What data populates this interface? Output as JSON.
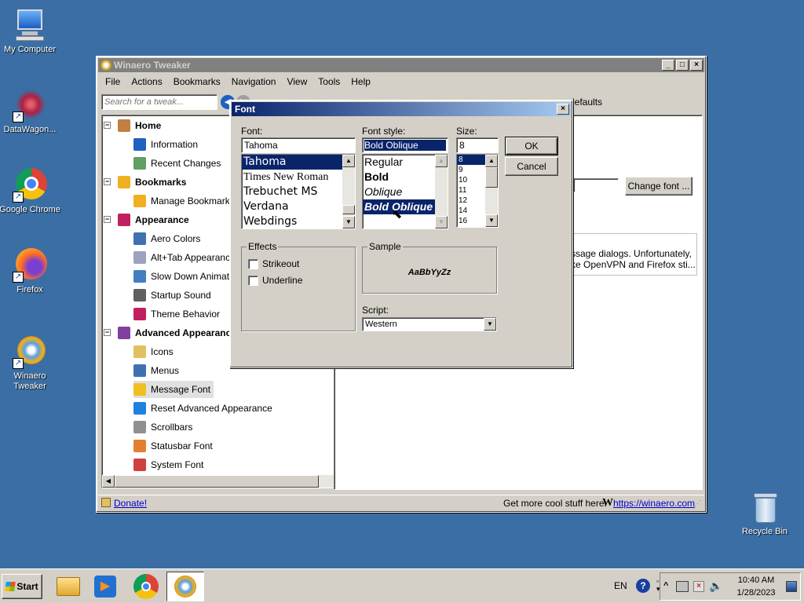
{
  "desktop": {
    "icons": [
      {
        "label": "My Computer"
      },
      {
        "label": "DataWagon..."
      },
      {
        "label": "Google Chrome"
      },
      {
        "label": "Firefox"
      },
      {
        "label": "Winaero\nTweaker"
      },
      {
        "label": "Recycle Bin"
      }
    ]
  },
  "main_window": {
    "title": "Winaero Tweaker",
    "menu": [
      "File",
      "Actions",
      "Bookmarks",
      "Navigation",
      "View",
      "Tools",
      "Help"
    ],
    "search_placeholder": "Search for a tweak...",
    "toolbar_defaults": "defaults",
    "change_font_label": "Change font ...",
    "description_line1": "ssage dialogs. Unfortunately,",
    "description_line2": "ke OpenVPN and Firefox sti...",
    "tree": [
      {
        "label": "Home",
        "bold": true
      },
      {
        "label": "Information"
      },
      {
        "label": "Recent Changes"
      },
      {
        "label": "Bookmarks",
        "bold": true
      },
      {
        "label": "Manage Bookmarks"
      },
      {
        "label": "Appearance",
        "bold": true
      },
      {
        "label": "Aero Colors"
      },
      {
        "label": "Alt+Tab Appearance"
      },
      {
        "label": "Slow Down Animations"
      },
      {
        "label": "Startup Sound"
      },
      {
        "label": "Theme Behavior"
      },
      {
        "label": "Advanced Appearance",
        "bold": true
      },
      {
        "label": "Icons"
      },
      {
        "label": "Menus"
      },
      {
        "label": "Message Font"
      },
      {
        "label": "Reset Advanced Appearance"
      },
      {
        "label": "Scrollbars"
      },
      {
        "label": "Statusbar Font"
      },
      {
        "label": "System Font"
      }
    ],
    "status": {
      "donate": "Donate!",
      "more": "Get more cool stuff here:",
      "url": "https://winaero.com"
    }
  },
  "font_dialog": {
    "title": "Font",
    "font_label": "Font:",
    "font_value": "Tahoma",
    "fonts": [
      "Tahoma",
      "Times New Roman",
      "Trebuchet MS",
      "Verdana",
      "Webdings"
    ],
    "style_label": "Font style:",
    "style_value": "Bold Oblique",
    "styles": [
      "Regular",
      "Bold",
      "Oblique",
      "Bold Oblique"
    ],
    "size_label": "Size:",
    "size_value": "8",
    "sizes": [
      "8",
      "9",
      "10",
      "11",
      "12",
      "14",
      "16"
    ],
    "ok": "OK",
    "cancel": "Cancel",
    "effects_label": "Effects",
    "strikeout": "Strikeout",
    "underline": "Underline",
    "sample_label": "Sample",
    "sample_text": "AaBbYyZz",
    "script_label": "Script:",
    "script_value": "Western"
  },
  "taskbar": {
    "start": "Start",
    "lang": "EN",
    "time": "10:40 AM",
    "date": "1/28/2023"
  }
}
